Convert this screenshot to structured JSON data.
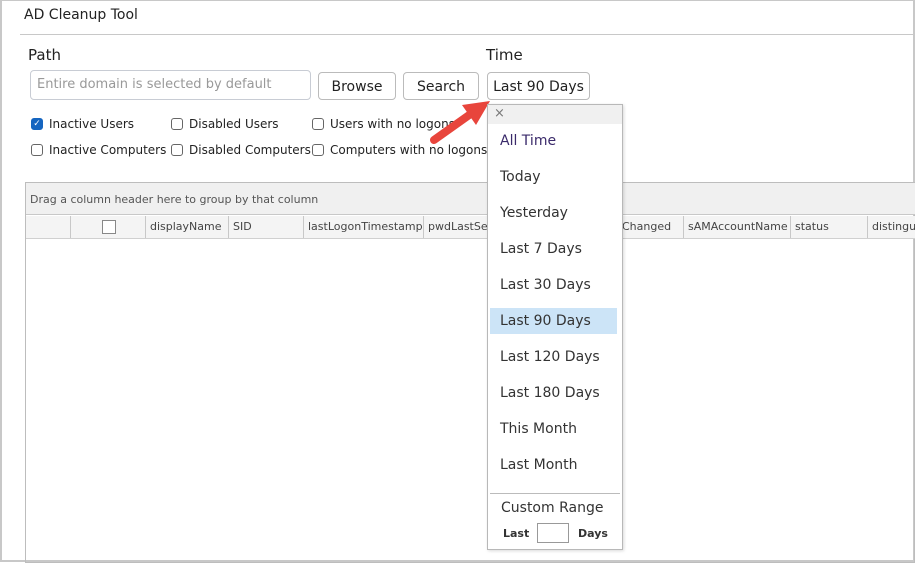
{
  "window": {
    "title": "AD Cleanup Tool"
  },
  "path": {
    "label": "Path",
    "placeholder": "Entire domain is selected by default",
    "browse_label": "Browse",
    "search_label": "Search"
  },
  "time": {
    "label": "Time",
    "selected": "Last 90 Days"
  },
  "filters": [
    {
      "label": "Inactive Users",
      "checked": true
    },
    {
      "label": "Disabled Users",
      "checked": false
    },
    {
      "label": "Users with no logons",
      "checked": false
    },
    {
      "label": "Inactive Computers",
      "checked": false
    },
    {
      "label": "Disabled Computers",
      "checked": false
    },
    {
      "label": "Computers with no logons",
      "checked": false
    }
  ],
  "grid": {
    "group_hint": "Drag a column header here to group by that column",
    "columns": [
      "displayName",
      "SID",
      "lastLogonTimestamp",
      "pwdLastSet",
      "Changed",
      "sAMAccountName",
      "status",
      "distinguis"
    ]
  },
  "dropdown": {
    "close_icon": "×",
    "items": [
      "All Time",
      "Today",
      "Yesterday",
      "Last 7 Days",
      "Last 30 Days",
      "Last 90 Days",
      "Last 120 Days",
      "Last 180 Days",
      "This Month",
      "Last Month"
    ],
    "selected_index": 5,
    "custom_range_label": "Custom Range",
    "last_label": "Last",
    "days_label": "Days",
    "days_value": ""
  },
  "colors": {
    "accent": "#1565c0",
    "selection": "#cce4f7",
    "arrow": "#e8453c"
  }
}
